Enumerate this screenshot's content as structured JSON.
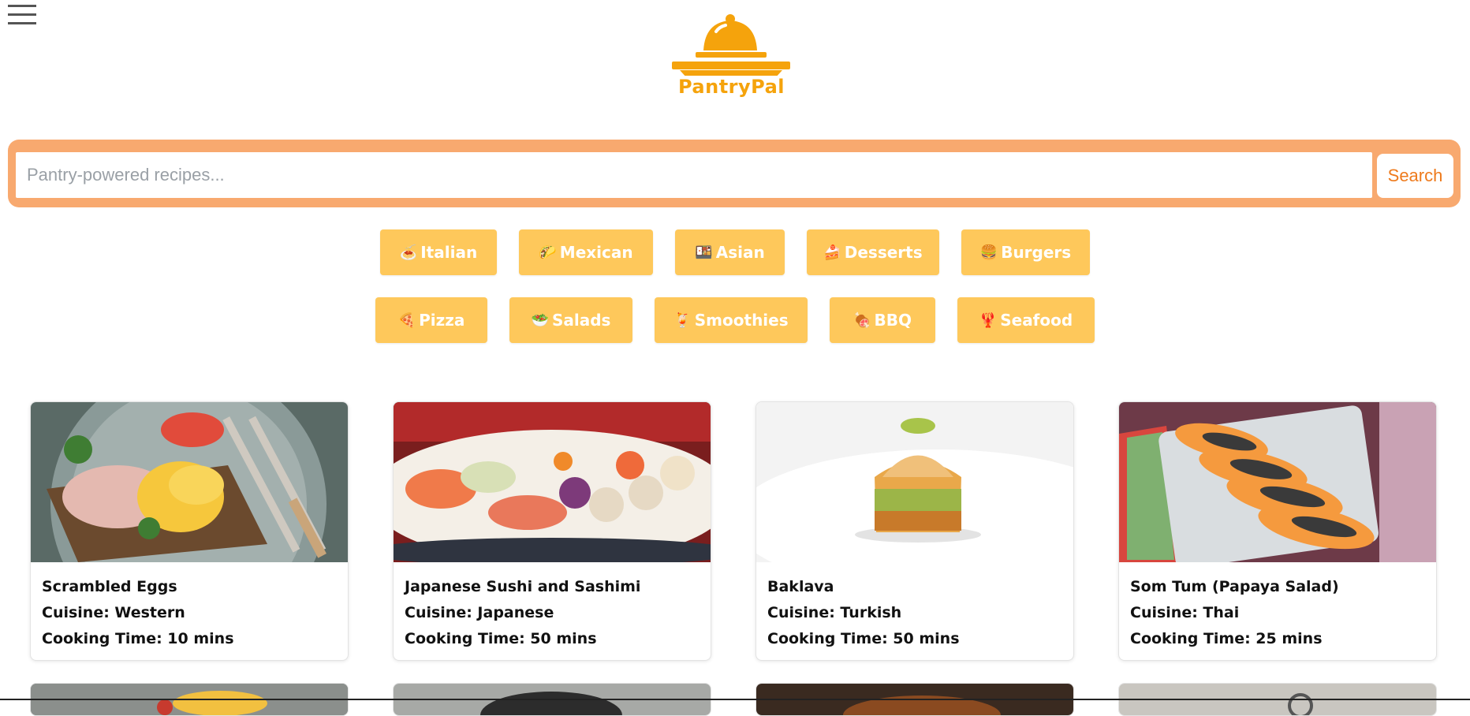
{
  "header": {
    "menu_icon": "hamburger-menu-icon",
    "brand": "PantryPal",
    "brand_color": "#f5a30c"
  },
  "search": {
    "placeholder": "Pantry-powered recipes...",
    "value": "",
    "button_label": "Search",
    "accent": "#f8a96f"
  },
  "categories": [
    {
      "emoji": "🍝",
      "label": "Italian"
    },
    {
      "emoji": "🌮",
      "label": "Mexican"
    },
    {
      "emoji": "🍱",
      "label": "Asian"
    },
    {
      "emoji": "🍰",
      "label": "Desserts"
    },
    {
      "emoji": "🍔",
      "label": "Burgers"
    },
    {
      "emoji": "🍕",
      "label": "Pizza"
    },
    {
      "emoji": "🥗",
      "label": "Salads"
    },
    {
      "emoji": "🍹",
      "label": "Smoothies"
    },
    {
      "emoji": "🍖",
      "label": "BBQ"
    },
    {
      "emoji": "🦞",
      "label": "Seafood"
    }
  ],
  "recipes": [
    {
      "title": "Scrambled Eggs",
      "cuisine": "Cuisine: Western",
      "time": "Cooking Time: 10 mins",
      "image": "scrambled-eggs-photo"
    },
    {
      "title": "Japanese Sushi and Sashimi",
      "cuisine": "Cuisine: Japanese",
      "time": "Cooking Time: 50 mins",
      "image": "sushi-platter-photo"
    },
    {
      "title": "Baklava",
      "cuisine": "Cuisine: Turkish",
      "time": "Cooking Time: 50 mins",
      "image": "baklava-photo"
    },
    {
      "title": "Som Tum (Papaya Salad)",
      "cuisine": "Cuisine: Thai",
      "time": "Cooking Time: 25 mins",
      "image": "papaya-photo"
    }
  ]
}
